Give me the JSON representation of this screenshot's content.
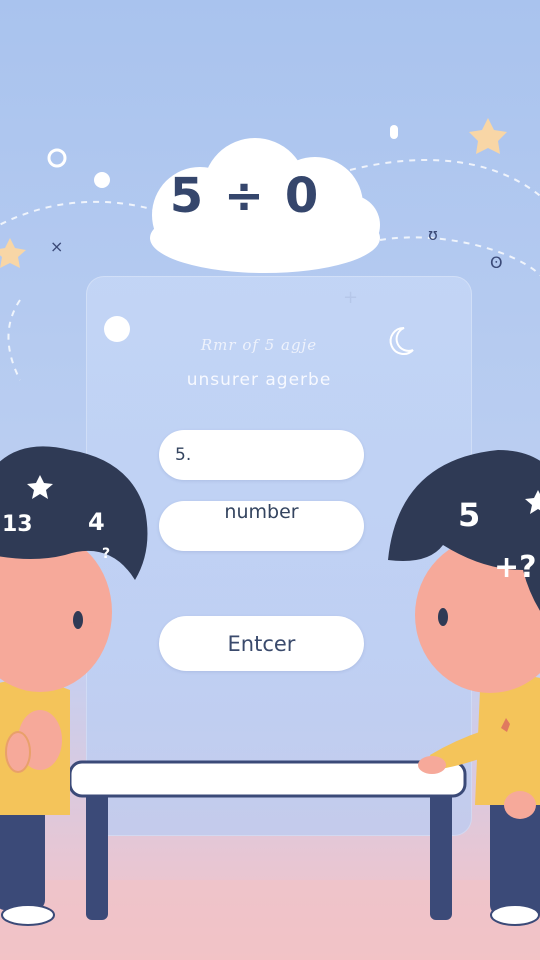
{
  "cloud": {
    "equation": "5 ÷ 0"
  },
  "card": {
    "line1": "Rmr of 5 agje",
    "line2": "unsurer agerbe"
  },
  "form": {
    "input_value": "5.",
    "number_label": "number",
    "enter_label": "Entcer"
  },
  "hair_numbers": {
    "left_13": "13",
    "left_4": "4",
    "left_q": "?",
    "right_5": "5",
    "right_plus": "+?"
  },
  "colors": {
    "accent_text": "#35466c",
    "panel": "#c4d6f6",
    "hair": "#2f3a55",
    "shirt": "#f4c45a",
    "pants": "#3b4a78",
    "skin": "#f6a99a"
  }
}
